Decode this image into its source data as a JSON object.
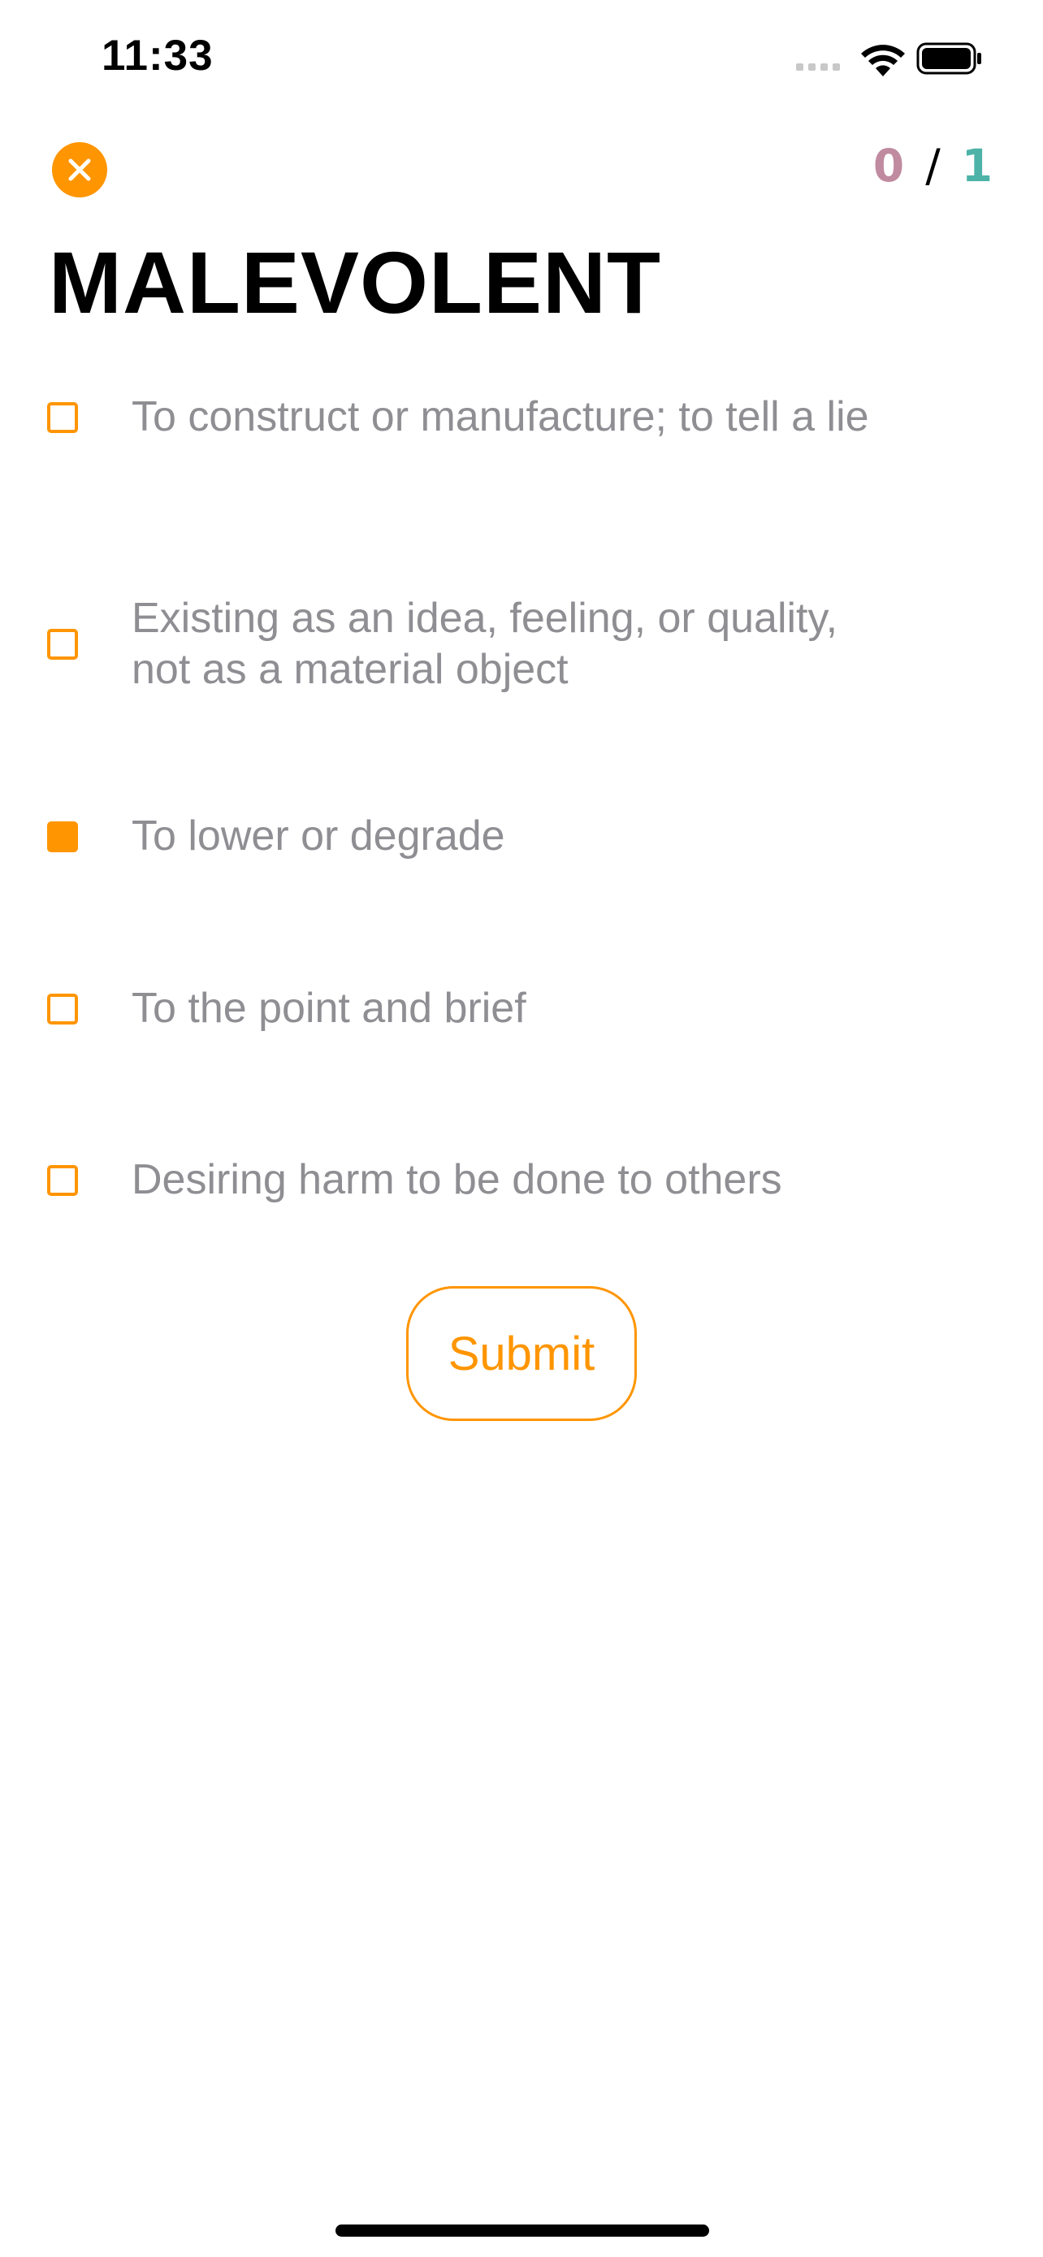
{
  "status_bar": {
    "time": "11:33"
  },
  "header": {
    "close_icon": "close-icon",
    "score_wrong": "0",
    "score_separator": "/",
    "score_right": "1"
  },
  "question": {
    "word": "MALEVOLENT"
  },
  "options": [
    {
      "text": "To construct or manufacture; to tell a lie",
      "checked": false
    },
    {
      "text": "Existing as an idea, feeling, or quality, not as a material object",
      "checked": false
    },
    {
      "text": "To lower or degrade",
      "checked": true
    },
    {
      "text": "To the point and brief",
      "checked": false
    },
    {
      "text": "Desiring harm to be done to others",
      "checked": false
    }
  ],
  "submit": {
    "label": "Submit"
  },
  "colors": {
    "accent": "#ff9500",
    "option_text": "#8e8e93",
    "score_wrong": "#c08a9f",
    "score_right": "#4db3a8"
  }
}
